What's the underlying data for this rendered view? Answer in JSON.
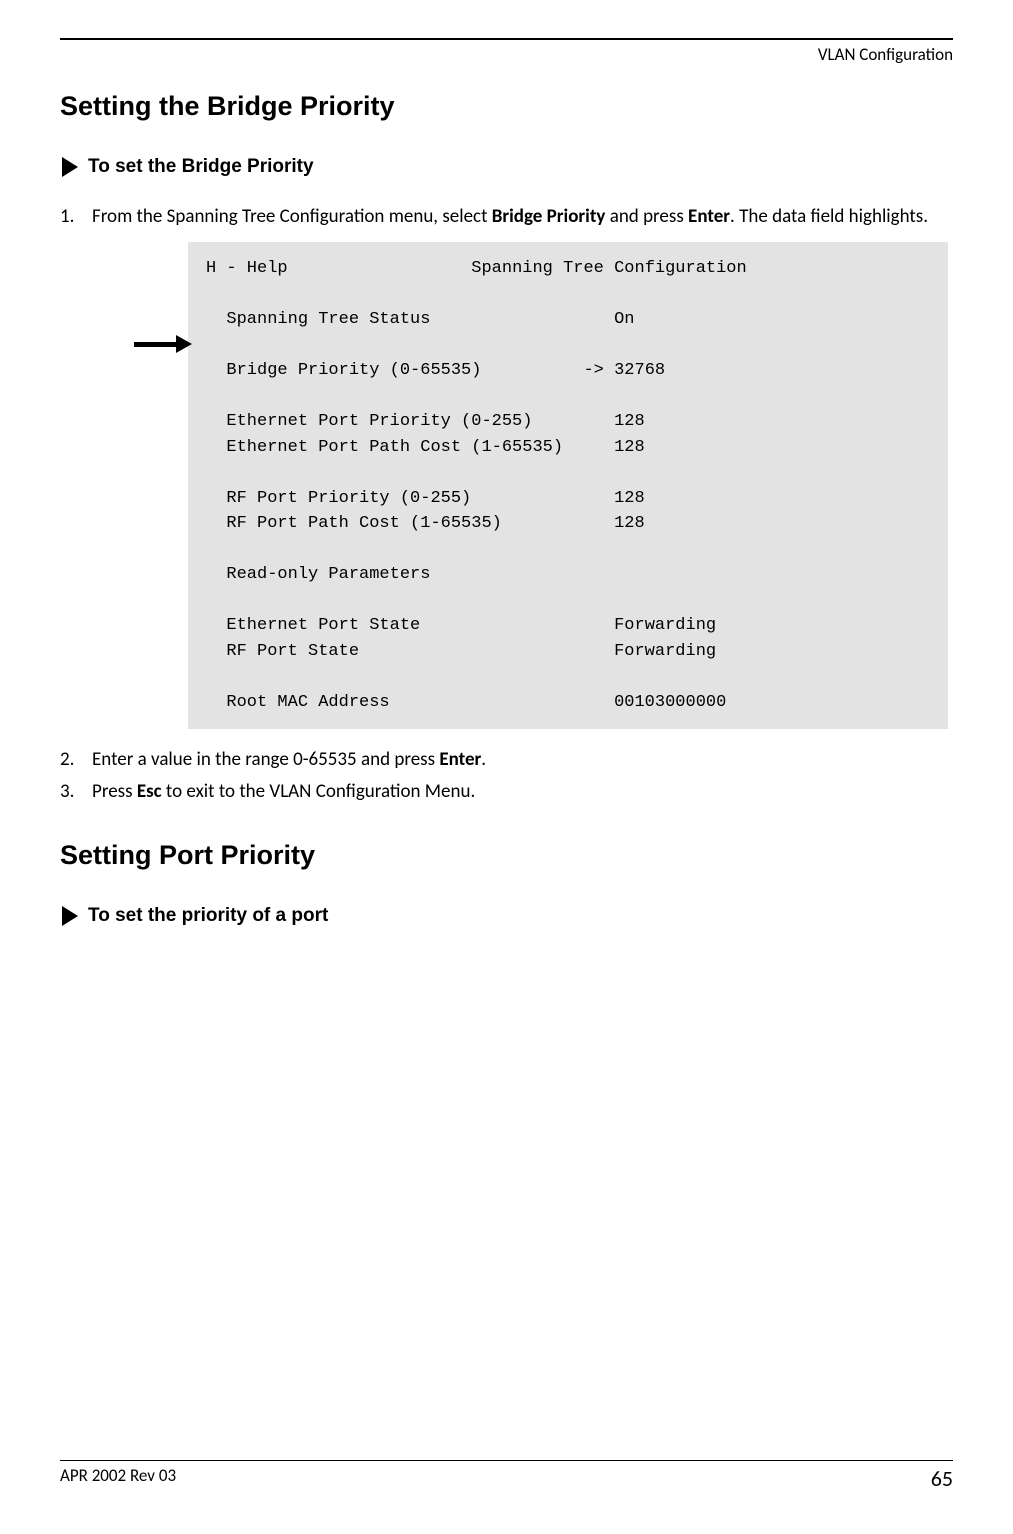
{
  "header": {
    "chapter": "VLAN Configuration"
  },
  "section1": {
    "title": "Setting the Bridge Priority",
    "proc_title": "To set the Bridge Priority",
    "step1_pre": "From the Spanning Tree Configuration menu, select ",
    "step1_b1": "Bridge Priority",
    "step1_mid": " and press ",
    "step1_b2": "Enter",
    "step1_post": ". The data field highlights.",
    "step2_pre": "Enter a value in the range 0-65535 and press ",
    "step2_b1": "Enter",
    "step2_post": ".",
    "step3_pre": "Press ",
    "step3_b1": "Esc",
    "step3_post": " to exit to the VLAN Configuration Menu."
  },
  "terminal": {
    "help_label": "H - Help",
    "screen_title": "Spanning Tree Configuration",
    "rows": {
      "st_status_label": "Spanning Tree Status",
      "st_status_val": "On",
      "bp_label": "Bridge Priority (0-65535)",
      "bp_marker": "->",
      "bp_val": "32768",
      "epp_label": "Ethernet Port Priority (0-255)",
      "epp_val": "128",
      "eppc_label": "Ethernet Port Path Cost (1-65535)",
      "eppc_val": "128",
      "rfp_label": "RF Port Priority (0-255)",
      "rfp_val": "128",
      "rfpc_label": "RF Port Path Cost (1-65535)",
      "rfpc_val": "128",
      "ro_label": "Read-only Parameters",
      "eps_label": "Ethernet Port State",
      "eps_val": "Forwarding",
      "rfs_label": "RF Port State",
      "rfs_val": "Forwarding",
      "mac_label": "Root MAC Address",
      "mac_val": "00103000000"
    }
  },
  "section2": {
    "title": "Setting Port Priority",
    "proc_title": "To set the priority of a port"
  },
  "footer": {
    "rev": "APR 2002 Rev 03",
    "page": "65"
  }
}
